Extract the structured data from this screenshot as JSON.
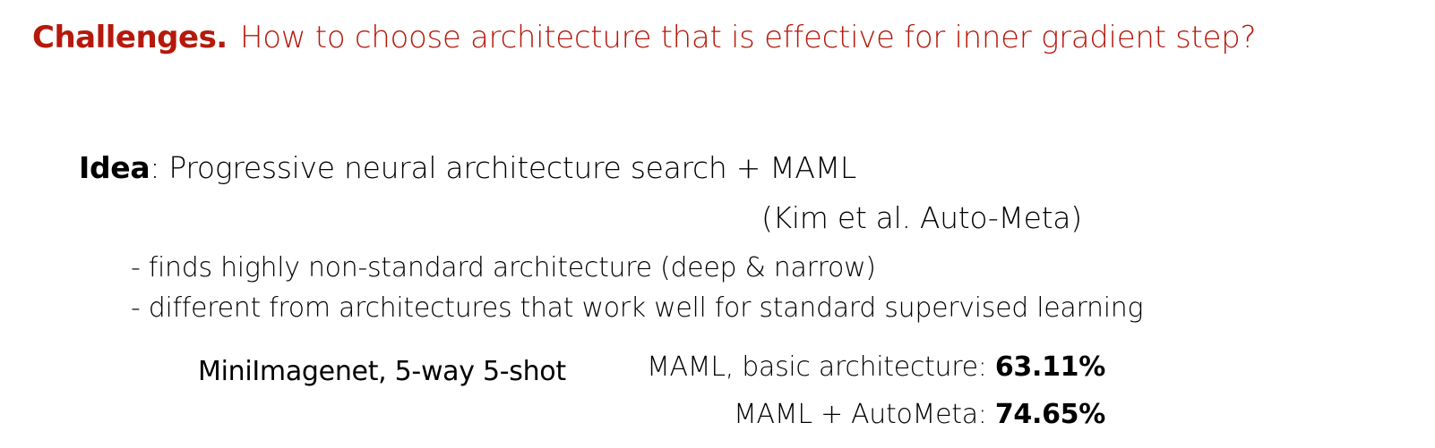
{
  "header": {
    "label": "Challenges.",
    "text": "How to choose architecture that is effective for inner gradient step?"
  },
  "idea": {
    "label": "Idea",
    "separator": ": ",
    "text": "Progressive neural architecture search + MAML",
    "citation": "(Kim et al. Auto-Meta)"
  },
  "bullets": [
    "- finds highly non-standard architecture (deep & narrow)",
    "- different from architectures that work well for standard supervised learning"
  ],
  "results": {
    "dataset": "MiniImagenet, 5-way 5-shot",
    "rows": [
      {
        "label": "MAML, basic architecture: ",
        "value": "63.11%"
      },
      {
        "label": "MAML + AutoMeta: ",
        "value": "74.65%"
      }
    ]
  },
  "colors": {
    "accent": "#b5190c"
  }
}
